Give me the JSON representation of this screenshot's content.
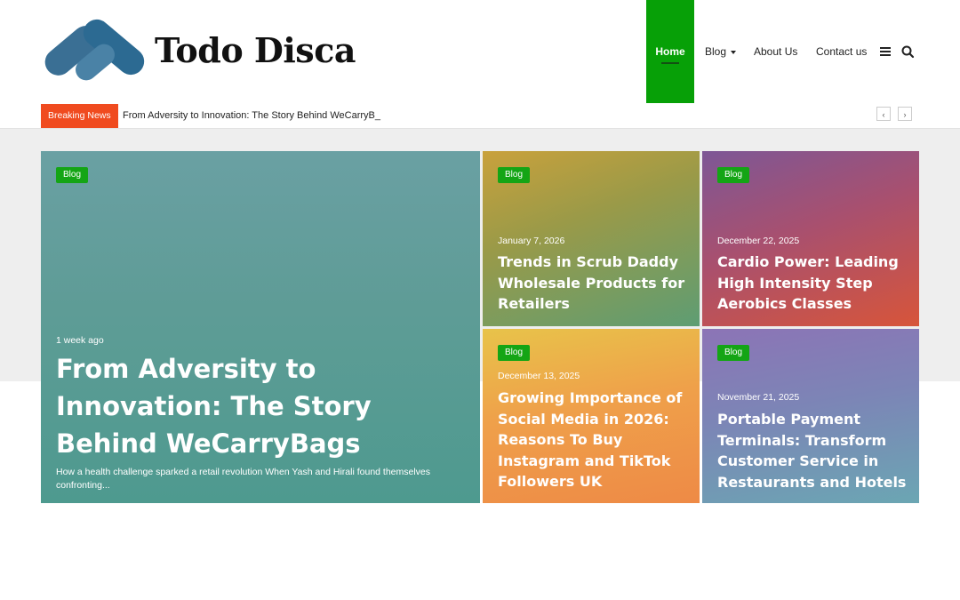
{
  "brand": {
    "name": "Todo Disca"
  },
  "nav": {
    "home": "Home",
    "blog": "Blog",
    "about": "About Us",
    "contact": "Contact us",
    "icons": [
      "menu-icon",
      "search-icon"
    ]
  },
  "breaking": {
    "label": "Breaking News",
    "headline": "From Adversity to Innovation: The Story Behind WeCarryB_",
    "prev": "‹",
    "next": "›"
  },
  "colors": {
    "accent": "#07a007",
    "breaking": "#f04b1f",
    "badge": "#14a515"
  },
  "featured": [
    {
      "category": "Blog",
      "date": "1 week ago",
      "title": "From Adversity to Innovation: The Story Behind WeCarryBags",
      "excerpt": "How a health challenge sparked a retail revolution When Yash and Hirali found themselves confronting..."
    },
    {
      "category": "Blog",
      "date": "January 7, 2026",
      "title": "Trends in Scrub Daddy Wholesale Products for Retailers"
    },
    {
      "category": "Blog",
      "date": "December 22, 2025",
      "title": "Cardio Power: Leading High Intensity Step Aerobics Classes"
    },
    {
      "category": "Blog",
      "date": "December 13, 2025",
      "title": "Growing Importance of Social Media in 2026: Reasons To Buy Instagram and TikTok Followers UK"
    },
    {
      "category": "Blog",
      "date": "November 21, 2025",
      "title": "Portable Payment Terminals: Transform Customer Service in Restaurants and Hotels"
    }
  ]
}
